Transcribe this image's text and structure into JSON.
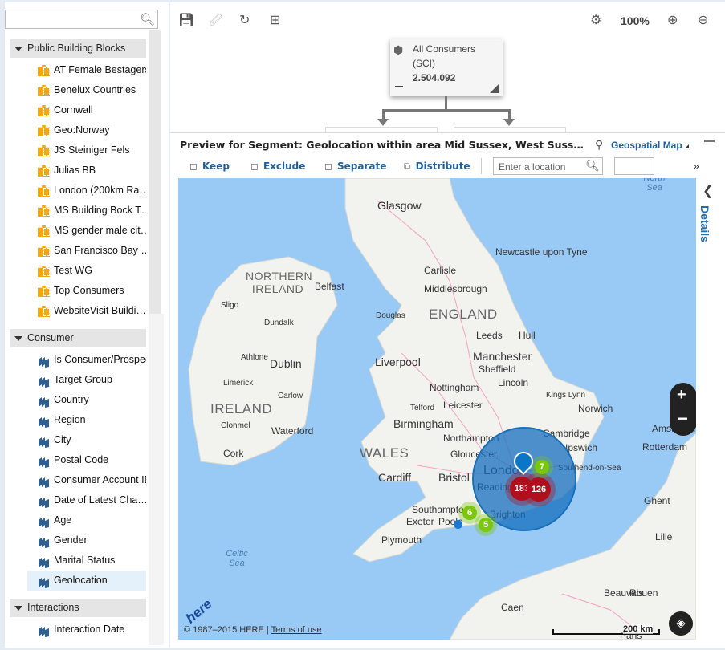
{
  "sidebar": {
    "search_placeholder": "",
    "groups": [
      {
        "label": "Public Building Blocks",
        "items": [
          "AT Female Bestagers",
          "Benelux Countries",
          "Cornwall",
          "Geo:Norway",
          "JS Steiniger Fels",
          "Julias BB",
          "London (200km Ra…",
          "MS Building Bock T…",
          "MS gender male cit…",
          "San Francisco Bay …",
          "Test WG",
          "Top Consumers",
          "WebsiteVisit Buildi…"
        ]
      },
      {
        "label": "Consumer",
        "items": [
          "Is Consumer/Prospect",
          "Target Group",
          "Country",
          "Region",
          "City",
          "Postal Code",
          "Consumer Account ID",
          "Date of Latest Cha…",
          "Age",
          "Gender",
          "Marital Status",
          "Geolocation"
        ],
        "selected": "Geolocation"
      },
      {
        "label": "Interactions",
        "items": [
          "Interaction Date"
        ]
      }
    ]
  },
  "toolbar": {
    "zoom": "100%"
  },
  "node": {
    "title": "All Consumers",
    "subtitle": "(SCI)",
    "count": "2.504.092"
  },
  "preview": {
    "title": "Preview for Segment: Geolocation within area Mid Sussex, West Suss…",
    "view": "Geospatial Map",
    "actions": [
      "Keep",
      "Exclude",
      "Separate",
      "Distribute"
    ],
    "location_placeholder": "Enter a location",
    "details": "Details"
  },
  "map": {
    "countries": [
      "NORTHERN IRELAND",
      "ENGLAND",
      "IRELAND",
      "WALES"
    ],
    "seas": [
      "North Sea",
      "Celtic Sea"
    ],
    "places": [
      "Glasgow",
      "Newcastle upon Tyne",
      "Carlisle",
      "Middlesbrough",
      "Belfast",
      "Douglas",
      "Leeds",
      "Hull",
      "Liverpool",
      "Manchester",
      "Sheffield",
      "Dublin",
      "Nottingham",
      "Lincoln",
      "Birmingham",
      "Leicester",
      "Norwich",
      "Cambridge",
      "Ipswich",
      "Cardiff",
      "Bristol",
      "Gloucester",
      "Northampton",
      "Southampton",
      "Exeter",
      "Poole",
      "Plymouth",
      "Brighton",
      "London",
      "Reading",
      "Amsterdam",
      "Rotterdam",
      "Ghent",
      "Lille",
      "Rouen",
      "Caen",
      "Beauvais",
      "Paris",
      "Cork",
      "Waterford",
      "Limerick",
      "Telford",
      "Kings Lynn",
      "Southend-on-Sea",
      "Clonmel",
      "Carlow",
      "Athlone",
      "Sligo",
      "Dundalk"
    ],
    "clusters": [
      {
        "count": "183",
        "color": "#b0101e"
      },
      {
        "count": "126",
        "color": "#b0101e"
      },
      {
        "count": "7",
        "color": "#7ac70c"
      },
      {
        "count": "6",
        "color": "#7ac70c"
      },
      {
        "count": "5",
        "color": "#7ac70c"
      }
    ],
    "copyright": "© 1987–2015 HERE | ",
    "terms": "Terms of use",
    "scale": "200 km",
    "logo": "here"
  }
}
